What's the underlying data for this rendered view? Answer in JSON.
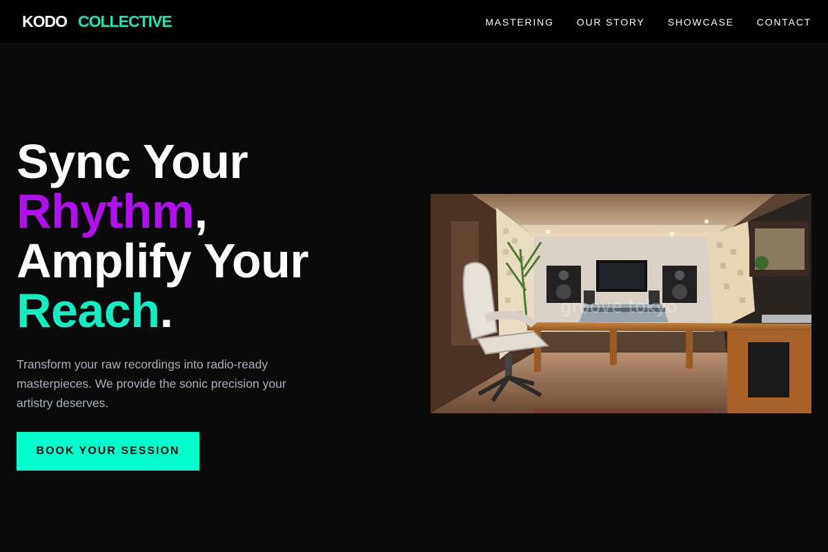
{
  "brand": {
    "word1": "KODO",
    "word2": "COLLECTIVE"
  },
  "nav": {
    "items": [
      {
        "label": "MASTERING"
      },
      {
        "label": "OUR STORY"
      },
      {
        "label": "SHOWCASE"
      },
      {
        "label": "CONTACT"
      }
    ]
  },
  "hero": {
    "line1": "Sync Your",
    "highlight1": "Rhythm",
    "comma": ",",
    "line3": "Amplify Your",
    "highlight2": "Reach",
    "period": ".",
    "description": "Transform your raw recordings into radio-ready masterpieces. We provide the sonic precision your artistry deserves.",
    "cta_label": "BOOK YOUR SESSION"
  },
  "image": {
    "watermark": "groove tokyo"
  },
  "colors": {
    "accent_teal": "#00ffcc",
    "accent_purple": "#b20ff0",
    "background": "#0a0a0a"
  }
}
